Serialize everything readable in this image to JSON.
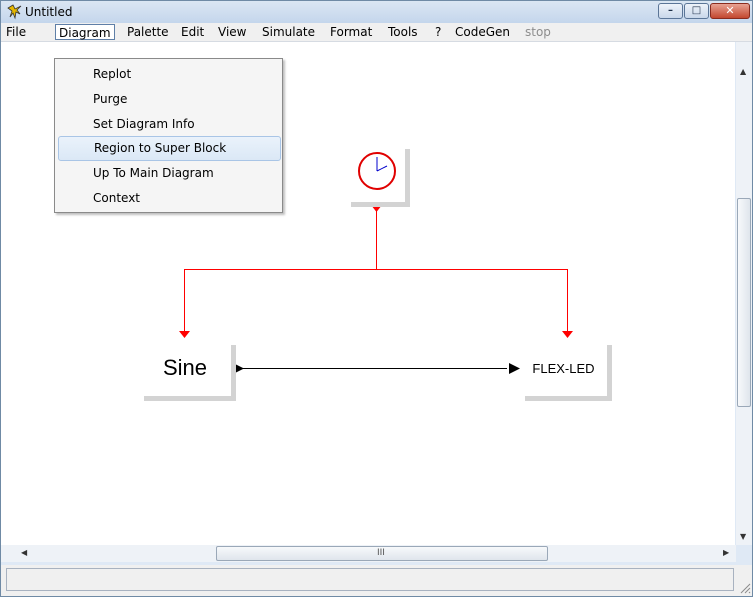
{
  "window": {
    "title": "Untitled",
    "controls": {
      "minimize": "–",
      "maximize": "□",
      "close": "✕"
    }
  },
  "menubar": {
    "items": [
      {
        "label": "File"
      },
      {
        "label": "Diagram"
      },
      {
        "label": "Palette"
      },
      {
        "label": "Edit"
      },
      {
        "label": "View"
      },
      {
        "label": "Simulate"
      },
      {
        "label": "Format"
      },
      {
        "label": "Tools"
      },
      {
        "label": "?"
      },
      {
        "label": "CodeGen"
      },
      {
        "label": "stop"
      }
    ],
    "open_menu": "Diagram",
    "disabled": [
      "stop"
    ]
  },
  "diagram_menu": {
    "items": [
      {
        "label": "Replot"
      },
      {
        "label": "Purge"
      },
      {
        "label": "Set Diagram Info"
      },
      {
        "label": "Region to Super Block"
      },
      {
        "label": "Up To Main Diagram"
      },
      {
        "label": "Context"
      }
    ],
    "highlighted": "Region to Super Block"
  },
  "canvas": {
    "blocks": {
      "clock": {
        "icon": "clock-icon"
      },
      "sine": {
        "label": "Sine"
      },
      "led": {
        "label": "FLEX-LED"
      }
    },
    "colors": {
      "event_link": "#ff0000",
      "data_link": "#000000",
      "clock_face": "#e00000",
      "clock_hands": "#0000cc",
      "block_shadow": "#d3d3d3"
    }
  },
  "scrollbars": {
    "grip": "III",
    "arrows": {
      "up": "▲",
      "down": "▼",
      "left": "◀",
      "right": "▶"
    }
  },
  "statusbar": {
    "text": ""
  },
  "colors": {
    "titlebar": "#c4d6ec",
    "menubar": "#f0f0f0",
    "highlight": "#dbe8f6",
    "close_button": "#c3472f"
  }
}
